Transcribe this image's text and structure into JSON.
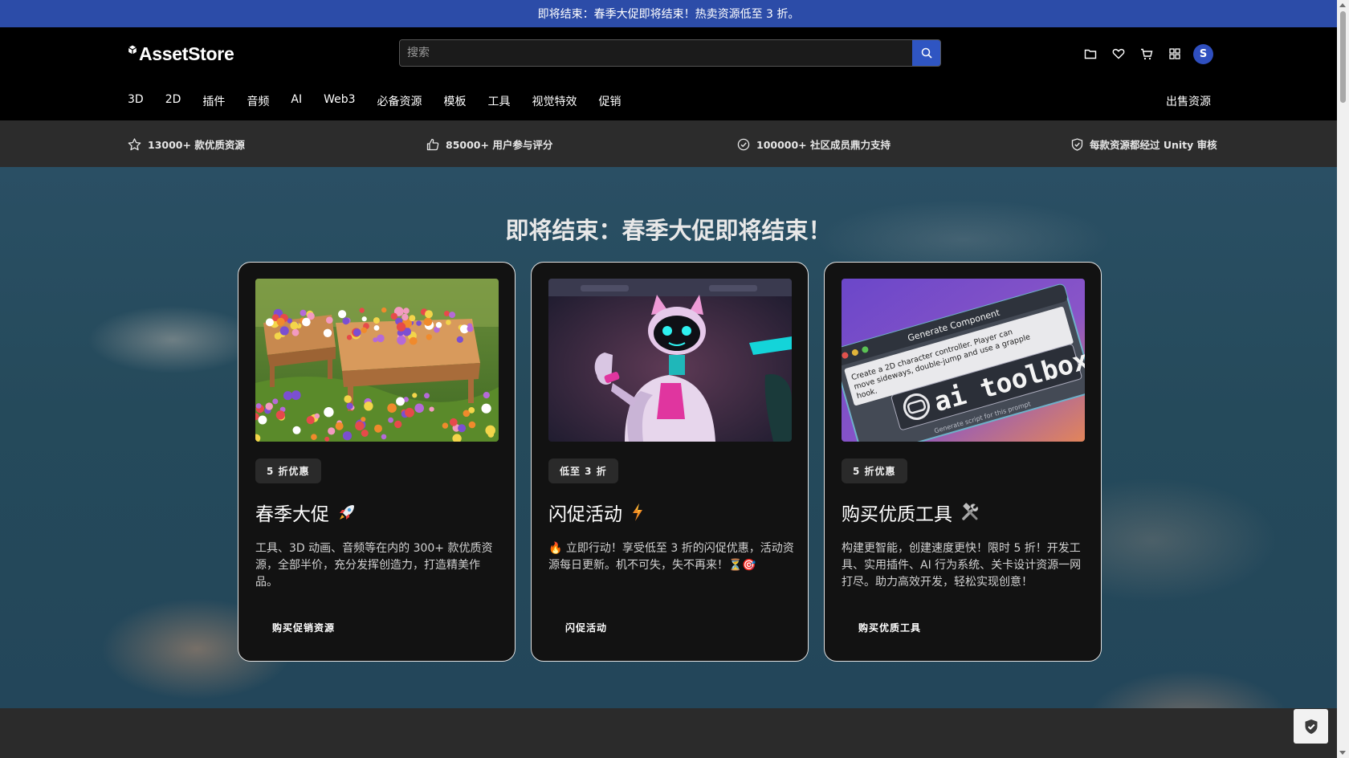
{
  "promo_banner": {
    "text": "即将结束：春季大促即将结束！热卖资源低至 3 折。"
  },
  "header": {
    "logo_text": "AssetStore",
    "search": {
      "placeholder": "搜索",
      "value": ""
    },
    "icons": [
      "folder-icon",
      "heart-icon",
      "cart-icon",
      "apps-grid-icon"
    ],
    "avatar_initial": "S",
    "nav_items": [
      "3D",
      "2D",
      "插件",
      "音频",
      "AI",
      "Web3",
      "必备资源",
      "模板",
      "工具",
      "视觉特效",
      "促销"
    ],
    "sell_label": "出售资源"
  },
  "stats": [
    {
      "icon": "star-icon",
      "text": "13000+ 款优质资源"
    },
    {
      "icon": "thumbs-up-icon",
      "text": "85000+ 用户参与评分"
    },
    {
      "icon": "check-circle-icon",
      "text": "100000+ 社区成员鼎力支持"
    },
    {
      "icon": "shield-check-icon",
      "text": "每款资源都经过 Unity 审核"
    }
  ],
  "hero": {
    "title": "即将结束：春季大促即将结束！"
  },
  "cards": [
    {
      "badge": "5 折优惠",
      "title": "春季大促",
      "title_icon": "rocket-icon",
      "image": "flower-garden-image",
      "desc": "工具、3D 动画、音频等在内的 300+ 款优质资源，全部半价，充分发挥创造力，打造精美作品。",
      "cta": "购买促销资源"
    },
    {
      "badge": "低至 3 折",
      "title": "闪促活动",
      "title_icon": "lightning-icon",
      "image": "robot-cat-character-image",
      "desc": "🔥 立即行动！享受低至 3 折的闪促优惠，活动资源每日更新。机不可失，失不再来！⏳🎯",
      "cta": "闪促活动"
    },
    {
      "badge": "5 折优惠",
      "title": "购买优质工具",
      "title_icon": "tools-icon",
      "image": "ai-toolbox-image",
      "desc": "构建更智能，创建速度更快！限时 5 折！开发工具、实用插件、AI 行为系统、关卡设计资源一网打尽。助力高效开发，轻松实现创意！",
      "cta": "购买优质工具"
    }
  ],
  "ai_toolbox_image": {
    "window_title": "Generate Component",
    "prompt": "Create a 2D character controller. Player can move sideways, double-jump and use a grapple hook.",
    "brand": "ai toolbox",
    "footer": "Generate script for this prompt"
  },
  "colors": {
    "promo_bar": "#2c4ca8",
    "accent": "#2f55c2",
    "header_bg": "#000000",
    "card_bg": "#121212"
  }
}
